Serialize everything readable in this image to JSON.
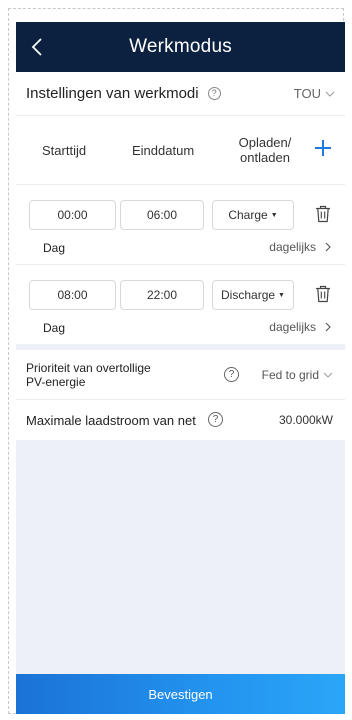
{
  "header": {
    "title": "Werkmodus"
  },
  "mode_row": {
    "label": "Instellingen van werkmodi",
    "help": "?",
    "value": "TOU"
  },
  "schedule_header": {
    "col_start": "Starttijd",
    "col_end": "Einddatum",
    "col_charge_line1": "Opladen/",
    "col_charge_line2": "ontladen"
  },
  "slots": [
    {
      "start": "00:00",
      "end": "06:00",
      "mode": "Charge",
      "day_label": "Dag",
      "frequency": "dagelijks"
    },
    {
      "start": "08:00",
      "end": "22:00",
      "mode": "Discharge",
      "day_label": "Dag",
      "frequency": "dagelijks"
    }
  ],
  "priority_row": {
    "label_line1": "Prioriteit van overtollige",
    "label_line2": "PV-energie",
    "help": "?",
    "value": "Fed to grid"
  },
  "max_charge_row": {
    "label": "Maximale laadstroom van net",
    "help": "?",
    "value": "30.000kW"
  },
  "confirm_button": {
    "label": "Bevestigen"
  },
  "colors": {
    "header_bg": "#0c2140",
    "accent": "#1f7ae0",
    "page_bg": "#eef0f7"
  }
}
